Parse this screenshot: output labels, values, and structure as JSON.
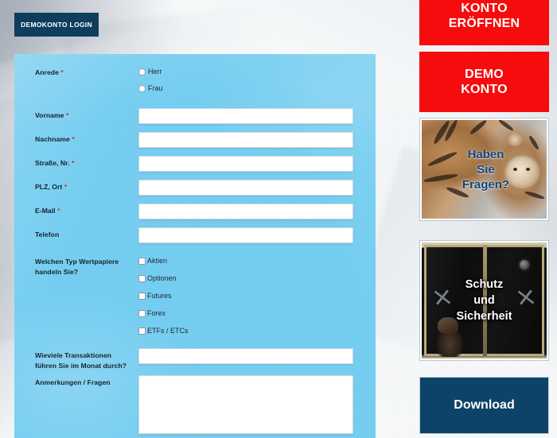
{
  "header": {
    "demo_login_label": "DEMOKONTO LOGIN"
  },
  "form": {
    "rows": {
      "anrede": {
        "label": "Anrede",
        "required": "*",
        "options": [
          "Herr",
          "Frau"
        ]
      },
      "vorname": {
        "label": "Vorname",
        "required": "*",
        "value": "",
        "placeholder": ""
      },
      "nachname": {
        "label": "Nachname",
        "required": "*",
        "value": "",
        "placeholder": ""
      },
      "strasse": {
        "label": "Straße, Nr.",
        "required": "*",
        "value": "",
        "placeholder": ""
      },
      "plz_ort": {
        "label": "PLZ, Ort",
        "required": "*",
        "value": "",
        "placeholder": ""
      },
      "email": {
        "label": "E-Mail",
        "required": "*",
        "value": "",
        "placeholder": ""
      },
      "telefon": {
        "label": "Telefon",
        "required": "",
        "value": "",
        "placeholder": ""
      },
      "wertpapiere": {
        "label_line1": "Welchen Typ Wertpapiere",
        "label_line2": "handeln Sie?",
        "options": [
          "Aktien",
          "Optionen",
          "Futures",
          "Forex",
          "ETFs / ETCs"
        ]
      },
      "transaktionen": {
        "label_line1": "Wieviele Transaktionen",
        "label_line2": "führen Sie im Monat durch?",
        "value": "",
        "placeholder": ""
      },
      "anmerkungen": {
        "label": "Anmerkungen / Fragen",
        "value": "",
        "placeholder": ""
      }
    }
  },
  "sidebar": {
    "cta_konto_eroeffnen": {
      "line1": "KONTO",
      "line2": "ERÖFFNEN"
    },
    "cta_demo_konto": {
      "line1": "DEMO",
      "line2": "KONTO"
    },
    "promo_fragen": {
      "line1": "Haben",
      "line2": "Sie",
      "line3": "Fragen?"
    },
    "promo_schutz": {
      "line1": "Schutz",
      "line2": "und",
      "line3": "Sicherheit"
    },
    "cta_download": {
      "label": "Download"
    }
  },
  "colors": {
    "navy": "#0e3d5e",
    "red": "#f60c0c",
    "panel_blue": "#74cdf0",
    "caption_blue": "#12457e",
    "required_red": "#c0392b",
    "download_navy": "#0e4368"
  }
}
